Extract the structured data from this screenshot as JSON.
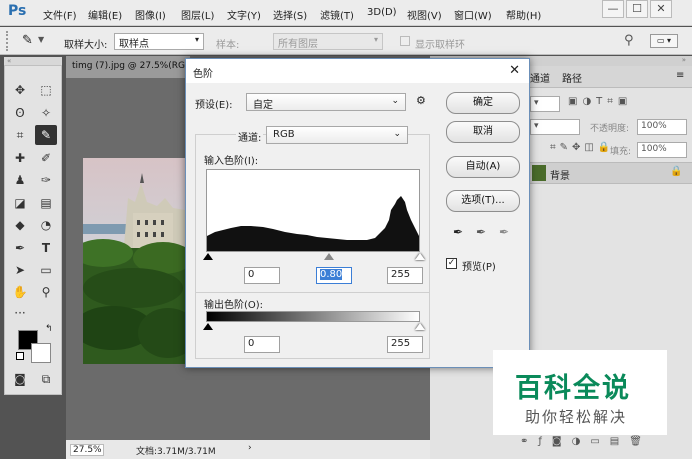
{
  "app": {
    "logo": "Ps"
  },
  "menubar": {
    "items": [
      "文件(F)",
      "编辑(E)",
      "图像(I)",
      "图层(L)",
      "文字(Y)",
      "选择(S)",
      "滤镜(T)",
      "3D(D)",
      "视图(V)",
      "窗口(W)",
      "帮助(H)"
    ],
    "window_buttons": [
      "—",
      "☐",
      "✕"
    ]
  },
  "options": {
    "sample_size_label": "取样大小:",
    "sample_size_value": "取样点",
    "sample_label": "样本:",
    "sample_value": "所有图层",
    "show_ring_label": "显示取样环"
  },
  "document": {
    "tab_title": "timg (7).jpg @ 27.5%(RG",
    "zoom": "27.5%",
    "doc_info": "文档:3.71M/3.71M"
  },
  "panels": {
    "tabs": [
      "通道",
      "路径"
    ],
    "opacity_label": "不透明度:",
    "opacity_value": "100%",
    "fill_label": "填充:",
    "fill_value": "100%",
    "layer_name": "背景"
  },
  "dialog": {
    "title": "色阶",
    "preset_label": "预设(E):",
    "preset_value": "自定",
    "channel_label": "通道:",
    "channel_value": "RGB",
    "input_levels_label": "输入色阶(I):",
    "input_black": "0",
    "input_gamma": "0.80",
    "input_white": "255",
    "output_levels_label": "输出色阶(O):",
    "output_black": "0",
    "output_white": "255",
    "ok_label": "确定",
    "cancel_label": "取消",
    "auto_label": "自动(A)",
    "options_label": "选项(T)...",
    "preview_label": "预览(P)",
    "preview_checked": true,
    "close_glyph": "✕"
  },
  "watermark": {
    "title": "百科全说",
    "subtitle": "助你轻松解决"
  }
}
